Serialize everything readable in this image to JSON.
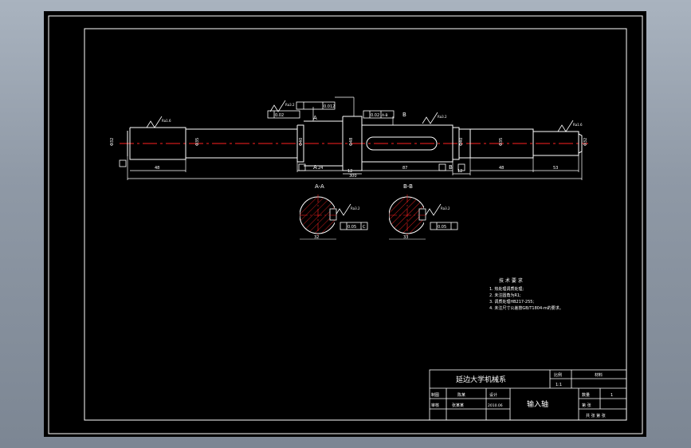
{
  "colors": {
    "sheet": "#000000",
    "line": "#ffffff",
    "center": "#ff2020",
    "hatch": "#ff2020"
  },
  "roughness": {
    "ra16": "Ra1.6",
    "ra32": "Ra3.2",
    "ra08": "Ra0.8"
  },
  "tolerance": {
    "top_left": "0.012",
    "top_right": "0.02",
    "left_box": "0.02",
    "right_box": "0.02",
    "datum": "A-B"
  },
  "datum": {
    "a": "A",
    "b": "B"
  },
  "dims": {
    "d1": "Φ32",
    "d2": "Φ35",
    "d3": "Φ40",
    "d4": "Φ48",
    "d5": "Φ40",
    "d6": "Φ35",
    "d7": "Φ32",
    "l1": "48",
    "l2": "24",
    "l3": "12",
    "l4": "87",
    "l5": "12",
    "l6": "48",
    "l7": "53",
    "total": "300"
  },
  "sections": {
    "aa_title": "A-A",
    "bb_title": "B-B",
    "aa_width": "32",
    "bb_width": "33",
    "aa_tol": "0.05",
    "bb_tol": "0.05",
    "datum_c": "C"
  },
  "notes": {
    "title": "技 术 要 求",
    "items": [
      "1. 热处理调质处理;",
      "2. 未注圆角为R1;",
      "3. 调质处理HB217-255;",
      "4. 未注尺寸公差按GB/T1804-m的要求。"
    ]
  },
  "title_block": {
    "school": "延边大学机械系",
    "part_name": "输入轴",
    "ratio_label": "比例",
    "ratio_value": "1:1",
    "material_label": "材料",
    "qty_label": "数量",
    "qty_value": "1",
    "sheet_label": "第 张",
    "drawn_label": "制图",
    "drawn_name": "陈某",
    "review_label": "审核",
    "design_label": "设计",
    "design_name": "张某某",
    "date": "2010.06",
    "sheet_info": "共 张 第 张"
  }
}
